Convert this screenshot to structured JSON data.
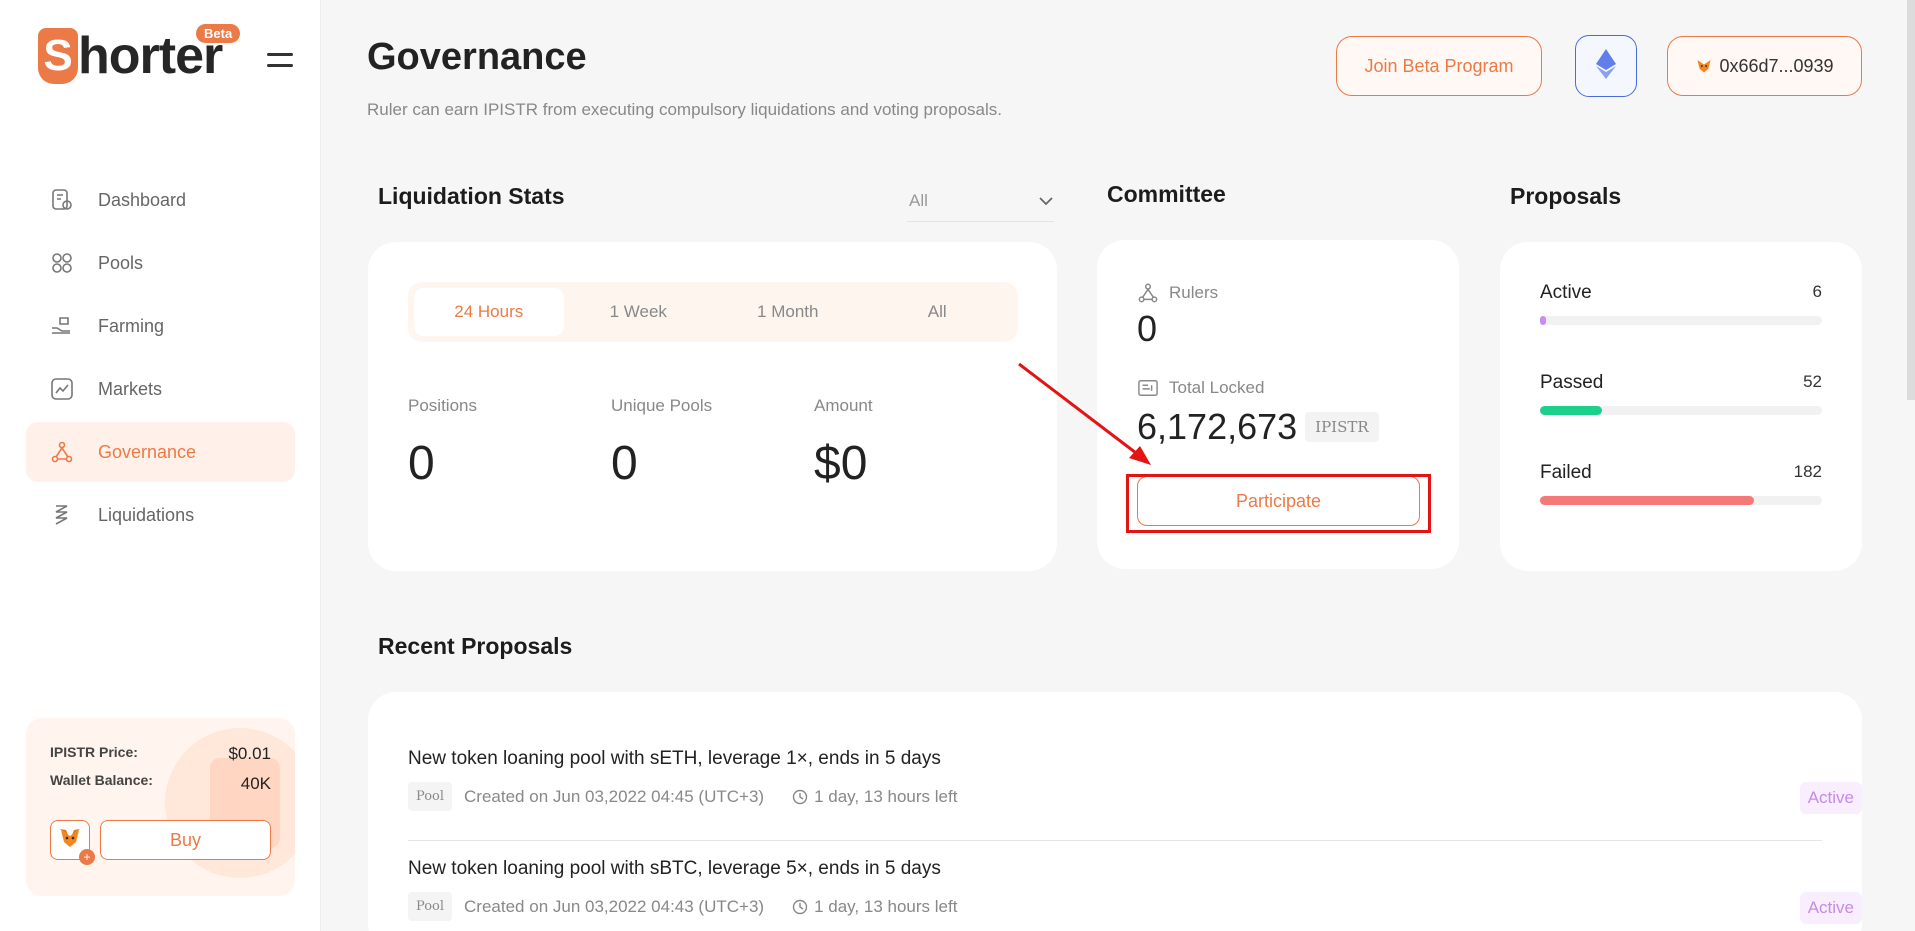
{
  "app": {
    "logo_letter": "S",
    "logo_text": "horter",
    "beta_label": "Beta"
  },
  "sidebar": {
    "items": [
      {
        "label": "Dashboard",
        "icon": "dashboard-icon"
      },
      {
        "label": "Pools",
        "icon": "pools-icon"
      },
      {
        "label": "Farming",
        "icon": "farming-icon"
      },
      {
        "label": "Markets",
        "icon": "markets-icon"
      },
      {
        "label": "Governance",
        "icon": "governance-icon",
        "active": true
      },
      {
        "label": "Liquidations",
        "icon": "liquidations-icon"
      }
    ],
    "price_card": {
      "price_label": "IPISTR Price:",
      "price_value": "$0.01",
      "balance_label": "Wallet Balance:",
      "balance_value": "40K",
      "buy_label": "Buy"
    }
  },
  "header": {
    "title": "Governance",
    "subtitle": "Ruler can earn IPISTR from executing compulsory liquidations and voting proposals.",
    "join_beta_label": "Join Beta Program",
    "wallet_label": "0x66d7...0939"
  },
  "liquidation": {
    "title": "Liquidation Stats",
    "filter_value": "All",
    "tabs": [
      "24 Hours",
      "1 Week",
      "1 Month",
      "All"
    ],
    "active_tab": 0,
    "stats": [
      {
        "label": "Positions",
        "value": "0"
      },
      {
        "label": "Unique Pools",
        "value": "0"
      },
      {
        "label": "Amount",
        "value": "$0"
      }
    ]
  },
  "committee": {
    "title": "Committee",
    "rulers_label": "Rulers",
    "rulers_value": "0",
    "locked_label": "Total Locked",
    "locked_value": "6,172,673",
    "locked_unit": "IPISTR",
    "participate_label": "Participate"
  },
  "proposals": {
    "title": "Proposals",
    "rows": [
      {
        "label": "Active",
        "count": "6",
        "fraction": 0.02,
        "color": "#c98cf0"
      },
      {
        "label": "Passed",
        "count": "52",
        "fraction": 0.22,
        "color": "#1ccf8a"
      },
      {
        "label": "Failed",
        "count": "182",
        "fraction": 0.76,
        "color": "#f57979"
      }
    ]
  },
  "recent": {
    "title": "Recent Proposals",
    "items": [
      {
        "title": "New token loaning pool with sETH, leverage 1×, ends in 5 days",
        "tag": "Pool",
        "created": "Created on Jun 03,2022 04:45 (UTC+3)",
        "time_left": "1 day, 13 hours left",
        "status": "Active"
      },
      {
        "title": "New token loaning pool with sBTC, leverage 5×, ends in 5 days",
        "tag": "Pool",
        "created": "Created on Jun 03,2022 04:43 (UTC+3)",
        "time_left": "1 day, 13 hours left",
        "status": "Active"
      }
    ]
  },
  "colors": {
    "accent": "#ec7a46",
    "highlight": "#e21414"
  }
}
